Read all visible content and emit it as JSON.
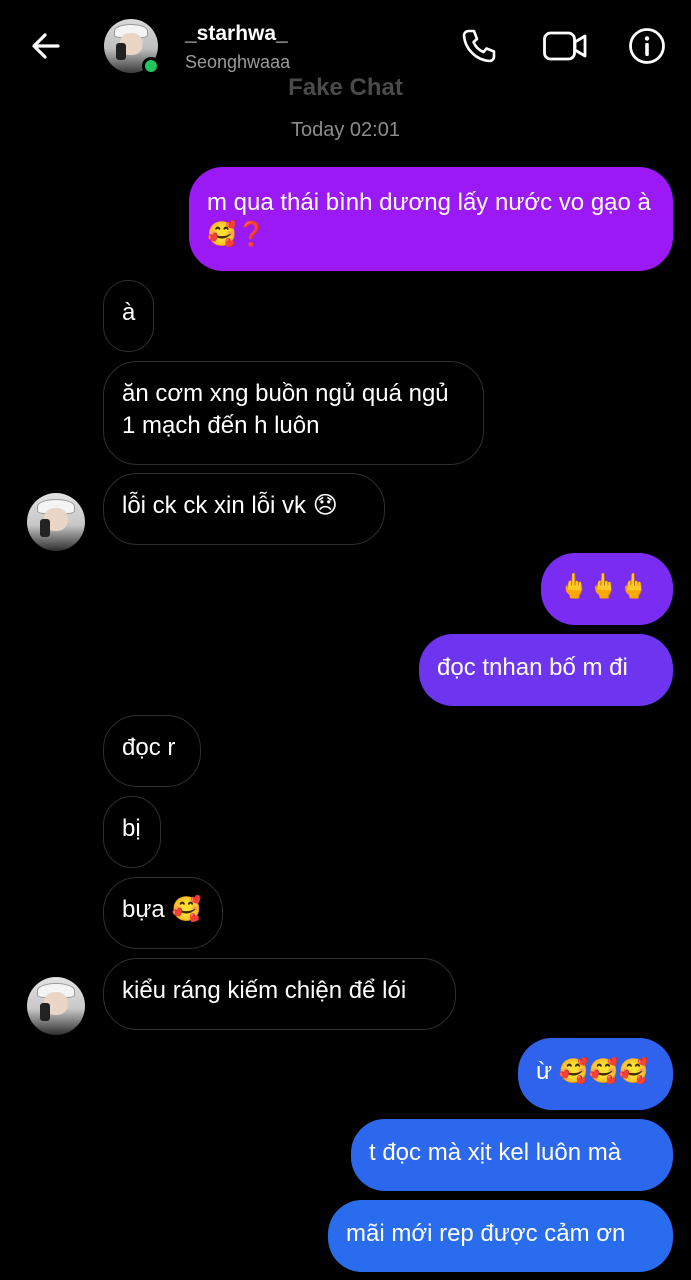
{
  "header": {
    "username": "_starhwa_",
    "display_name": "Seonghwaaa",
    "online_color": "#22c55e",
    "icons": [
      "back-arrow-icon",
      "phone-icon",
      "video-camera-icon",
      "info-icon"
    ]
  },
  "watermark": "Fake Chat",
  "timestamp": "Today 02:01",
  "messages": [
    {
      "side": "out",
      "text": "m qua thái bình dương lấy nước vo gạo à",
      "emoji": "🥰❓",
      "color": "#9b19f5"
    },
    {
      "side": "in",
      "text": "à"
    },
    {
      "side": "in",
      "text": "ăn cơm xng buồn ngủ quá ngủ 1 mạch đến h luôn"
    },
    {
      "side": "in",
      "text": "lỗi ck ck xin lỗi vk",
      "emoji": "😞"
    },
    {
      "side": "out",
      "text": "",
      "emoji": "🖕🖕🖕",
      "color": "#7a2cf2"
    },
    {
      "side": "out",
      "text": "đọc tnhan bố m đi",
      "color": "#6d35f0"
    },
    {
      "side": "in",
      "text": "đọc r"
    },
    {
      "side": "in",
      "text": "bị"
    },
    {
      "side": "in",
      "text": "bựa",
      "emoji": "🥰"
    },
    {
      "side": "in",
      "text": "kiểu ráng kiếm chiện để lói"
    },
    {
      "side": "out",
      "text": "ừ",
      "emoji": "🥰🥰🥰",
      "color": "#2f63ee"
    },
    {
      "side": "out",
      "text": "t đọc mà xịt kel luôn mà",
      "color": "#2c68ee"
    },
    {
      "side": "out",
      "text": "mãi mới rep được cảm ơn",
      "color": "#2a6cee"
    }
  ]
}
